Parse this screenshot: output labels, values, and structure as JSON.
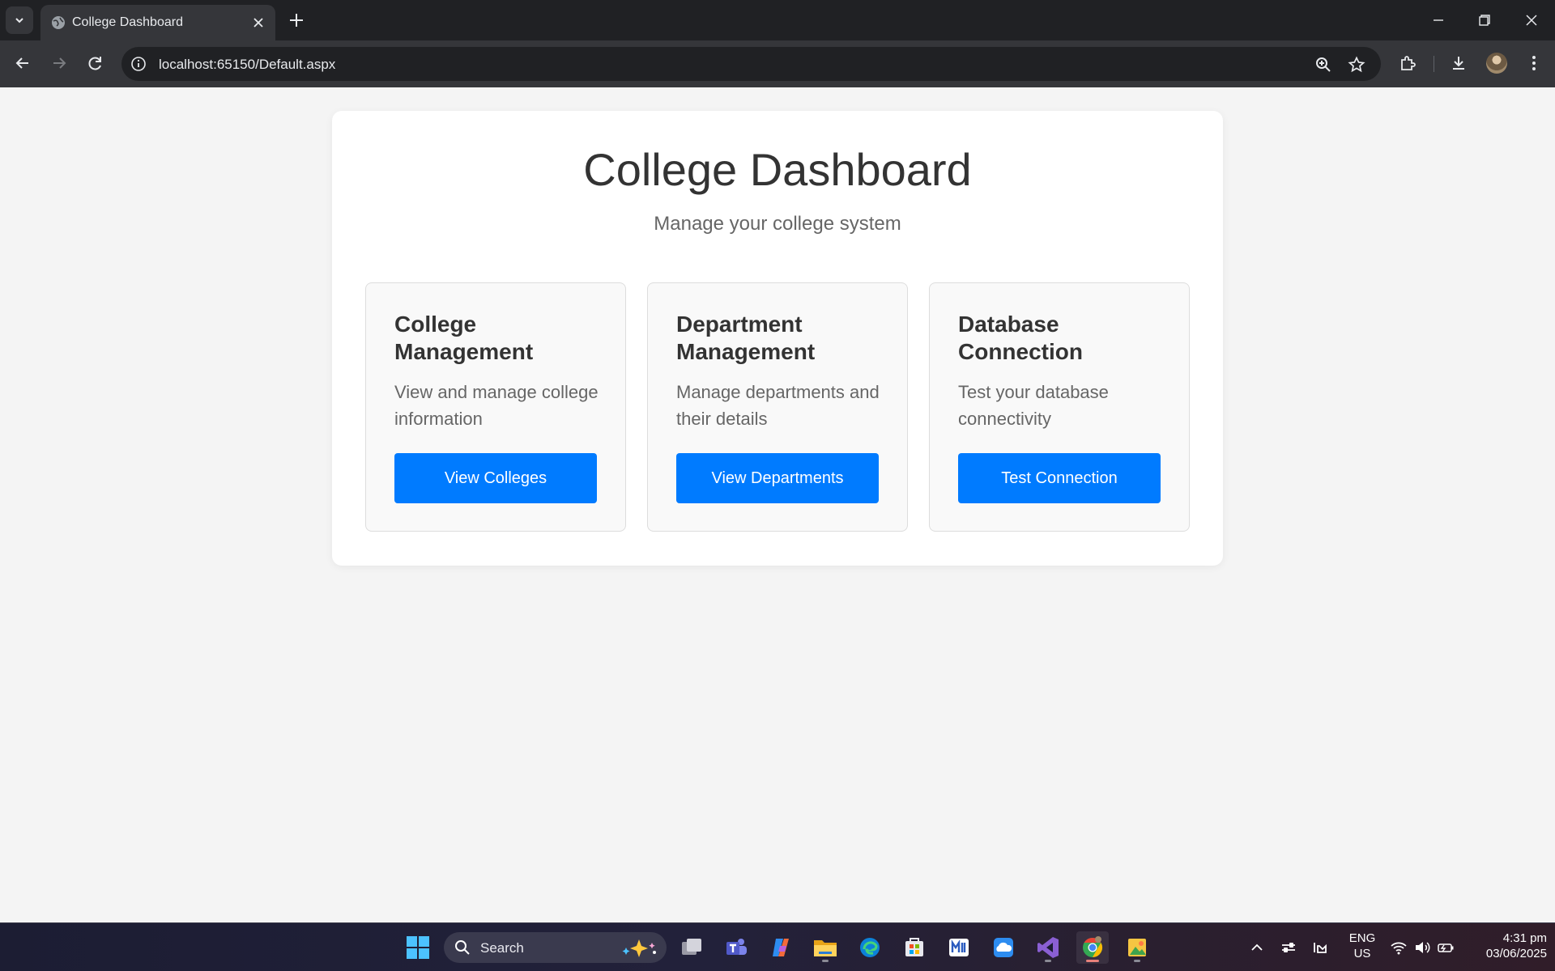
{
  "browser": {
    "tab_title": "College Dashboard",
    "url": "localhost:65150/Default.aspx"
  },
  "page": {
    "title": "College Dashboard",
    "subtitle": "Manage your college system",
    "accent_color": "#007bff",
    "cards": [
      {
        "heading": "College Management",
        "description": "View and manage college information",
        "button_label": "View Colleges"
      },
      {
        "heading": "Department Management",
        "description": "Manage departments and their details",
        "button_label": "View Departments"
      },
      {
        "heading": "Database Connection",
        "description": "Test your database connectivity",
        "button_label": "Test Connection"
      }
    ]
  },
  "taskbar": {
    "search_placeholder": "Search",
    "apps": [
      "start-icon",
      "task-view-icon",
      "teams-icon",
      "copilot-icon",
      "file-explorer-icon",
      "edge-icon",
      "store-icon",
      "mail-icon",
      "onedrive-icon",
      "visual-studio-icon",
      "chrome-icon",
      "photos-icon"
    ],
    "language_line1": "ENG",
    "language_line2": "US",
    "time": "4:31 pm",
    "date": "03/06/2025"
  }
}
